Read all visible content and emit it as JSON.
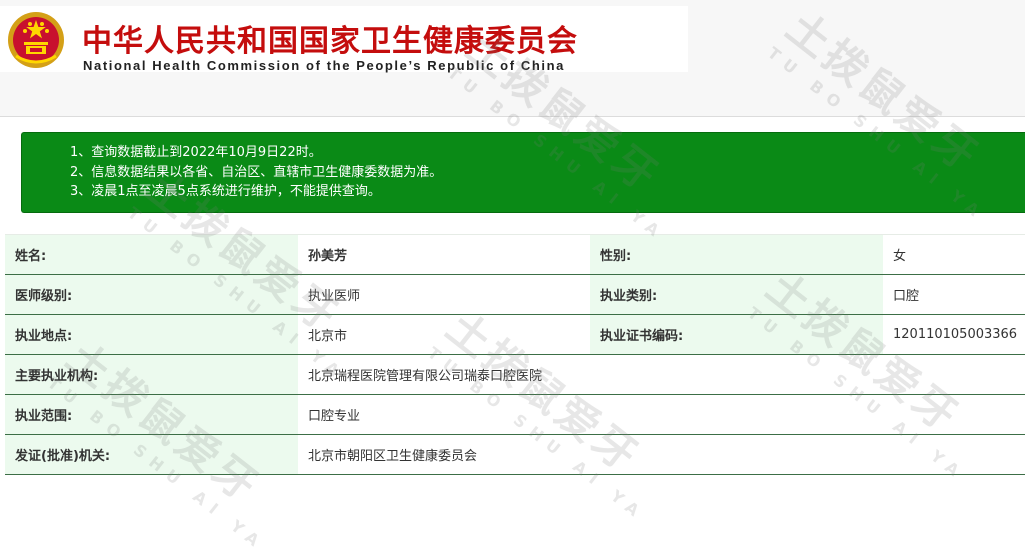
{
  "header": {
    "title_cn": "中华人民共和国国家卫生健康委员会",
    "title_en": "National Health Commission of the People’s Republic of China",
    "emblem_icon": "national-emblem-icon"
  },
  "notice": {
    "items": [
      "1、查询数据截止到2022年10月9日22时。",
      "2、信息数据结果以各省、自治区、直辖市卫生健康委数据为准。",
      "3、凌晨1点至凌晨5点系统进行维护，不能提供查询。"
    ]
  },
  "record": {
    "name_label": "姓名:",
    "name": "孙美芳",
    "gender_label": "性别:",
    "gender": "女",
    "level_label": "医师级别:",
    "level": "执业医师",
    "category_label": "执业类别:",
    "category": "口腔",
    "location_label": "执业地点:",
    "location": "北京市",
    "cert_label": "执业证书编码:",
    "cert": "120110105003366",
    "institution_label": "主要执业机构:",
    "institution": "北京瑞程医院管理有限公司瑞泰口腔医院",
    "scope_label": "执业范围:",
    "scope": "口腔专业",
    "authority_label": "发证(批准)机关:",
    "authority": "北京市朝阳区卫生健康委员会"
  },
  "watermark": {
    "text": "土拨鼠爱牙",
    "pinyin": "TU BO SHU AI YA"
  },
  "colors": {
    "title_red": "#c40d0d",
    "notice_green": "#0a8a16",
    "label_bg": "#ecfaee",
    "row_border": "#3c6e46"
  }
}
